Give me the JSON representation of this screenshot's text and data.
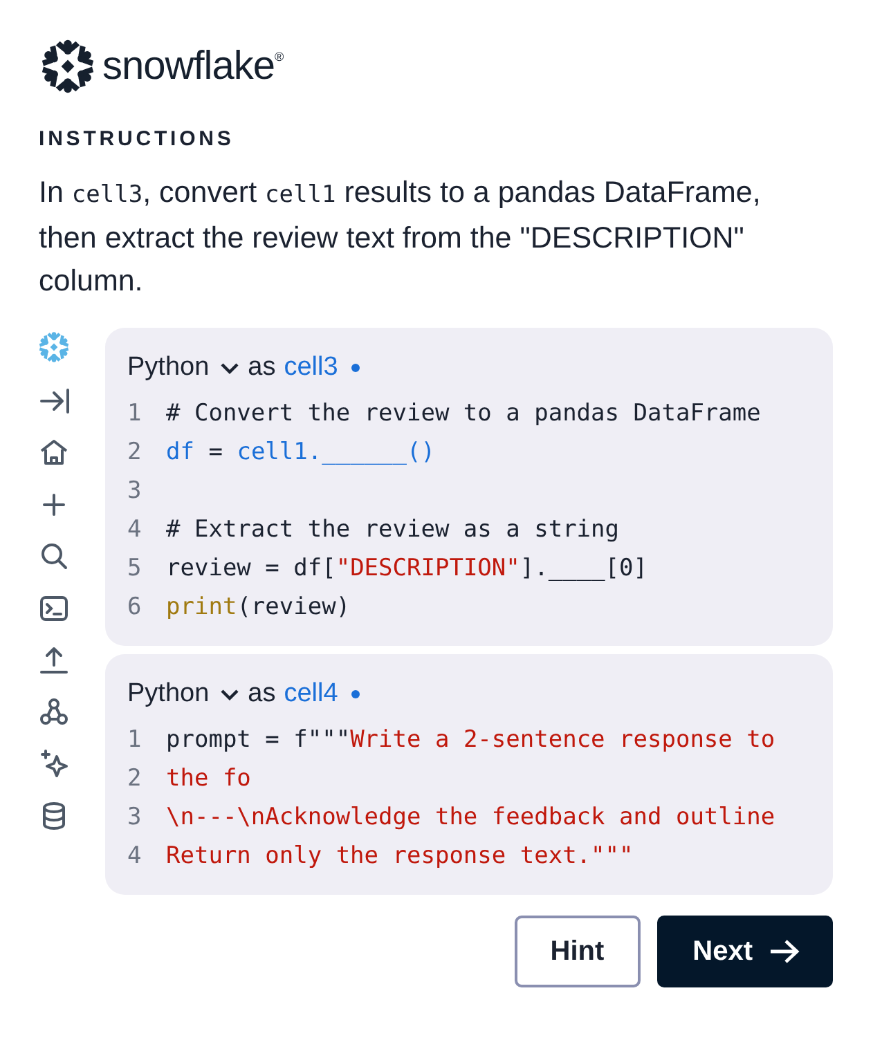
{
  "logo": {
    "wordmark": "snowflake",
    "mark": "®"
  },
  "section_label": "INSTRUCTIONS",
  "instructions": [
    {
      "kind": "text",
      "text": "In "
    },
    {
      "kind": "code",
      "text": "cell3"
    },
    {
      "kind": "text",
      "text": ", convert "
    },
    {
      "kind": "code",
      "text": "cell1"
    },
    {
      "kind": "text",
      "text": " results to a pandas DataFrame, then extract the review text from the \"DESCRIPTION\" column."
    }
  ],
  "cells": [
    {
      "language": "Python",
      "as": "as",
      "name": "cell3",
      "lines": [
        {
          "number": "1",
          "tokens": [
            {
              "kind": "plain",
              "text": "# Convert the review to a pandas DataFrame"
            }
          ]
        },
        {
          "number": "2",
          "tokens": [
            {
              "kind": "blue",
              "text": "df"
            },
            {
              "kind": "plain",
              "text": " = "
            },
            {
              "kind": "blue",
              "text": "cell1.______()"
            }
          ]
        },
        {
          "number": "3"
        },
        {
          "number": "4",
          "tokens": [
            {
              "kind": "plain",
              "text": "# Extract the review as a string"
            }
          ]
        },
        {
          "number": "5",
          "tokens": [
            {
              "kind": "plain",
              "text": "review = df["
            },
            {
              "kind": "string",
              "text": "\"DESCRIPTION\""
            },
            {
              "kind": "plain",
              "text": "].____[0]"
            }
          ]
        },
        {
          "number": "6",
          "tokens": [
            {
              "kind": "builtin",
              "text": "print"
            },
            {
              "kind": "plain",
              "text": "(review)"
            }
          ]
        }
      ]
    },
    {
      "language": "Python",
      "as": "as",
      "name": "cell4",
      "lines": [
        {
          "number": "1",
          "tokens": [
            {
              "kind": "plain",
              "text": "prompt = f\"\"\""
            },
            {
              "kind": "string",
              "text": "Write a 2-sentence response to"
            }
          ]
        },
        {
          "number": "2",
          "tokens": [
            {
              "kind": "string",
              "text": "the fo"
            }
          ]
        },
        {
          "number": "3",
          "tokens": [
            {
              "kind": "string",
              "text": "\\n---\\nAcknowledge the feedback and outline"
            }
          ]
        },
        {
          "number": "4",
          "tokens": [
            {
              "kind": "string",
              "text": "Return only the response text.\"\"\""
            }
          ]
        }
      ]
    }
  ],
  "buttons": [
    {
      "label": "Hint",
      "kind": "secondary"
    },
    {
      "label": "Next",
      "kind": "primary"
    }
  ]
}
